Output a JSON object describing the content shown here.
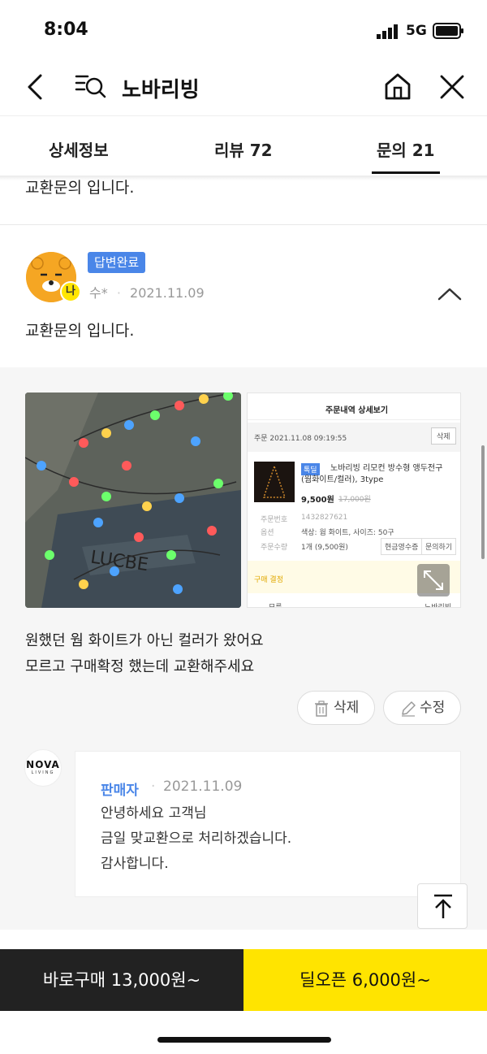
{
  "status_bar": {
    "time": "8:04",
    "network": "5G"
  },
  "header": {
    "title": "노바리빙"
  },
  "tabs": [
    {
      "label": "상세정보"
    },
    {
      "label": "리뷰 72"
    },
    {
      "label": "문의 21",
      "active": true
    }
  ],
  "prev_question": {
    "text": "교환문의 입니다."
  },
  "question": {
    "status": "답변완료",
    "author": "수*",
    "date": "2021.11.09",
    "title": "교환문의 입니다.",
    "avatar_badge": "나",
    "body_lines": [
      "원했던 웜 화이트가 아닌 컬러가 왔어요",
      "모르고 구매확정 했는데 교환해주세요"
    ],
    "actions": {
      "delete": "삭제",
      "edit": "수정"
    }
  },
  "order_screenshot": {
    "title": "주문내역 상세보기",
    "order_date": "주문 2021.11.08 09:19:55",
    "delete": "삭제",
    "tag": "톡딜",
    "product_name": "노바리빙 리모컨 방수형 앵두전구 (웜화이트/컬러), 3type",
    "price": "9,500원",
    "orig_price": "17,000원",
    "rows": [
      {
        "k": "주문번호",
        "v": "1432827621"
      },
      {
        "k": "옵션",
        "v": "색상: 웜 화이트, 사이즈: 50구"
      },
      {
        "k": "주문수량",
        "v": "1개 (9,500원)"
      }
    ],
    "btn_receipt": "현금영수증",
    "btn_inquiry": "문의하기",
    "purchase_confirm": "구매 결정",
    "footer_left": "모름",
    "footer_right": "노바리빙"
  },
  "reply": {
    "logo_text": "NOVA",
    "logo_sub": "LIVING",
    "seller": "판매자",
    "date": "2021.11.09",
    "lines": [
      "안녕하세요 고객님",
      "금일 맞교환으로 처리하겠습니다.",
      "감사합니다."
    ]
  },
  "bottom_bar": {
    "buy_now": "바로구매 13,000원~",
    "deal": "딜오픈 6,000원~"
  },
  "colors": {
    "accent_yellow": "#ffe400",
    "badge_blue": "#4a86e8",
    "dark": "#222222"
  }
}
